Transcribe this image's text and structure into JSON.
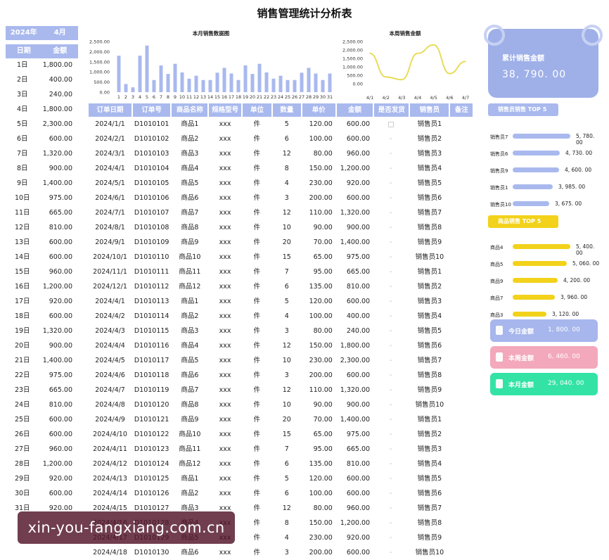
{
  "title": "销售管理统计分析表",
  "left": {
    "year": "2024年",
    "month": "4月",
    "col_day": "日期",
    "col_amount": "金额",
    "days": [
      [
        "1日",
        "1,800.00"
      ],
      [
        "2日",
        "400.00"
      ],
      [
        "3日",
        "240.00"
      ],
      [
        "4日",
        "1,800.00"
      ],
      [
        "5日",
        "2,300.00"
      ],
      [
        "6日",
        "600.00"
      ],
      [
        "7日",
        "1,320.00"
      ],
      [
        "8日",
        "900.00"
      ],
      [
        "9日",
        "1,400.00"
      ],
      [
        "10日",
        "975.00"
      ],
      [
        "11日",
        "665.00"
      ],
      [
        "12日",
        "810.00"
      ],
      [
        "13日",
        "600.00"
      ],
      [
        "14日",
        "600.00"
      ],
      [
        "15日",
        "960.00"
      ],
      [
        "16日",
        "1,200.00"
      ],
      [
        "17日",
        "920.00"
      ],
      [
        "18日",
        "600.00"
      ],
      [
        "19日",
        "1,320.00"
      ],
      [
        "20日",
        "900.00"
      ],
      [
        "21日",
        "1,400.00"
      ],
      [
        "22日",
        "975.00"
      ],
      [
        "23日",
        "665.00"
      ],
      [
        "24日",
        "810.00"
      ],
      [
        "25日",
        "600.00"
      ],
      [
        "26日",
        "600.00"
      ],
      [
        "27日",
        "960.00"
      ],
      [
        "28日",
        "1,200.00"
      ],
      [
        "29日",
        "920.00"
      ],
      [
        "30日",
        "600.00"
      ],
      [
        "31日",
        "920.00"
      ]
    ]
  },
  "chart_data": [
    {
      "type": "bar",
      "title": "本月销售数据图",
      "categories": [
        "1",
        "2",
        "3",
        "4",
        "5",
        "6",
        "7",
        "8",
        "9",
        "10",
        "11",
        "12",
        "13",
        "14",
        "15",
        "16",
        "17",
        "18",
        "19",
        "20",
        "21",
        "22",
        "23",
        "24",
        "25",
        "26",
        "27",
        "28",
        "29",
        "30",
        "31"
      ],
      "values": [
        1800,
        400,
        240,
        1800,
        2300,
        600,
        1320,
        900,
        1400,
        975,
        665,
        810,
        600,
        600,
        960,
        1200,
        920,
        600,
        1320,
        900,
        1400,
        975,
        665,
        810,
        600,
        600,
        960,
        1200,
        920,
        600,
        920
      ],
      "yticks": [
        "2,500.00",
        "2,000.00",
        "1,500.00",
        "1,000.00",
        "500.00",
        "0.00"
      ],
      "ylim": [
        0,
        2500
      ],
      "color": "#a9b9ee"
    },
    {
      "type": "line",
      "title": "本周销售金额",
      "categories": [
        "4/1",
        "4/2",
        "4/3",
        "4/4",
        "4/5",
        "4/6",
        "4/7"
      ],
      "values": [
        1800,
        400,
        240,
        1800,
        2300,
        600,
        1320
      ],
      "yticks": [
        "2,500.00",
        "2,000.00",
        "1,500.00",
        "1,000.00",
        "500.00",
        "0.00"
      ],
      "ylim": [
        0,
        2500
      ],
      "color": "#e8dc5a"
    }
  ],
  "table": {
    "headers": [
      "订单日期",
      "订单号",
      "商品名称",
      "规格型号",
      "单位",
      "数量",
      "单价",
      "金额",
      "是否发货",
      "销售员",
      "备注"
    ],
    "rows": [
      [
        "2024/1/1",
        "D1010101",
        "商品1",
        "xxx",
        "件",
        "5",
        "120.00",
        "600.00",
        "chk",
        "销售员1"
      ],
      [
        "2024/2/1",
        "D1010102",
        "商品2",
        "xxx",
        "件",
        "6",
        "100.00",
        "600.00",
        "-",
        "销售员2"
      ],
      [
        "2024/3/1",
        "D1010103",
        "商品3",
        "xxx",
        "件",
        "12",
        "80.00",
        "960.00",
        "-",
        "销售员3"
      ],
      [
        "2024/4/1",
        "D1010104",
        "商品4",
        "xxx",
        "件",
        "8",
        "150.00",
        "1,200.00",
        "-",
        "销售员4"
      ],
      [
        "2024/5/1",
        "D1010105",
        "商品5",
        "xxx",
        "件",
        "4",
        "230.00",
        "920.00",
        "-",
        "销售员5"
      ],
      [
        "2024/6/1",
        "D1010106",
        "商品6",
        "xxx",
        "件",
        "3",
        "200.00",
        "600.00",
        "-",
        "销售员6"
      ],
      [
        "2024/7/1",
        "D1010107",
        "商品7",
        "xxx",
        "件",
        "12",
        "110.00",
        "1,320.00",
        "-",
        "销售员7"
      ],
      [
        "2024/8/1",
        "D1010108",
        "商品8",
        "xxx",
        "件",
        "10",
        "90.00",
        "900.00",
        "-",
        "销售员8"
      ],
      [
        "2024/9/1",
        "D1010109",
        "商品9",
        "xxx",
        "件",
        "20",
        "70.00",
        "1,400.00",
        "-",
        "销售员9"
      ],
      [
        "2024/10/1",
        "D1010110",
        "商品10",
        "xxx",
        "件",
        "15",
        "65.00",
        "975.00",
        "-",
        "销售员10"
      ],
      [
        "2024/11/1",
        "D1010111",
        "商品11",
        "xxx",
        "件",
        "7",
        "95.00",
        "665.00",
        "-",
        "销售员1"
      ],
      [
        "2024/12/1",
        "D1010112",
        "商品12",
        "xxx",
        "件",
        "6",
        "135.00",
        "810.00",
        "-",
        "销售员2"
      ],
      [
        "2024/4/1",
        "D1010113",
        "商品1",
        "xxx",
        "件",
        "5",
        "120.00",
        "600.00",
        "-",
        "销售员3"
      ],
      [
        "2024/4/2",
        "D1010114",
        "商品2",
        "xxx",
        "件",
        "4",
        "100.00",
        "400.00",
        "-",
        "销售员4"
      ],
      [
        "2024/4/3",
        "D1010115",
        "商品3",
        "xxx",
        "件",
        "3",
        "80.00",
        "240.00",
        "-",
        "销售员5"
      ],
      [
        "2024/4/4",
        "D1010116",
        "商品4",
        "xxx",
        "件",
        "12",
        "150.00",
        "1,800.00",
        "-",
        "销售员6"
      ],
      [
        "2024/4/5",
        "D1010117",
        "商品5",
        "xxx",
        "件",
        "10",
        "230.00",
        "2,300.00",
        "-",
        "销售员7"
      ],
      [
        "2024/4/6",
        "D1010118",
        "商品6",
        "xxx",
        "件",
        "3",
        "200.00",
        "600.00",
        "-",
        "销售员8"
      ],
      [
        "2024/4/7",
        "D1010119",
        "商品7",
        "xxx",
        "件",
        "12",
        "110.00",
        "1,320.00",
        "-",
        "销售员9"
      ],
      [
        "2024/4/8",
        "D1010120",
        "商品8",
        "xxx",
        "件",
        "10",
        "90.00",
        "900.00",
        "-",
        "销售员10"
      ],
      [
        "2024/4/9",
        "D1010121",
        "商品9",
        "xxx",
        "件",
        "20",
        "70.00",
        "1,400.00",
        "-",
        "销售员1"
      ],
      [
        "2024/4/10",
        "D1010122",
        "商品10",
        "xxx",
        "件",
        "15",
        "65.00",
        "975.00",
        "-",
        "销售员2"
      ],
      [
        "2024/4/11",
        "D1010123",
        "商品11",
        "xxx",
        "件",
        "7",
        "95.00",
        "665.00",
        "-",
        "销售员3"
      ],
      [
        "2024/4/12",
        "D1010124",
        "商品12",
        "xxx",
        "件",
        "6",
        "135.00",
        "810.00",
        "-",
        "销售员4"
      ],
      [
        "2024/4/13",
        "D1010125",
        "商品1",
        "xxx",
        "件",
        "5",
        "120.00",
        "600.00",
        "-",
        "销售员5"
      ],
      [
        "2024/4/14",
        "D1010126",
        "商品2",
        "xxx",
        "件",
        "6",
        "100.00",
        "600.00",
        "-",
        "销售员6"
      ],
      [
        "2024/4/15",
        "D1010127",
        "商品3",
        "xxx",
        "件",
        "12",
        "80.00",
        "960.00",
        "-",
        "销售员7"
      ],
      [
        "2024/4/16",
        "D1010128",
        "商品4",
        "xxx",
        "件",
        "8",
        "150.00",
        "1,200.00",
        "-",
        "销售员8"
      ],
      [
        "2024/4/17",
        "D1010129",
        "商品5",
        "xxx",
        "件",
        "4",
        "230.00",
        "920.00",
        "-",
        "销售员9"
      ],
      [
        "2024/4/18",
        "D1010130",
        "商品6",
        "xxx",
        "件",
        "3",
        "200.00",
        "600.00",
        "-",
        "销售员10"
      ]
    ]
  },
  "right": {
    "total_label": "累计销售金额",
    "total_value": "38, 790. 00",
    "seller_tag": "销售员销售 TOP 5",
    "sellers": [
      {
        "name": "销售员7",
        "value": "5, 780. 00",
        "fraction": 1.0
      },
      {
        "name": "销售员6",
        "value": "4, 730. 00",
        "fraction": 0.82
      },
      {
        "name": "销售员9",
        "value": "4, 600. 00",
        "fraction": 0.8
      },
      {
        "name": "销售员1",
        "value": "3, 985. 00",
        "fraction": 0.69
      },
      {
        "name": "销售员10",
        "value": "3, 675. 00",
        "fraction": 0.64
      }
    ],
    "product_tag": "商品销售 TOP 5",
    "products": [
      {
        "name": "商品4",
        "value": "5, 400. 00",
        "fraction": 1.0
      },
      {
        "name": "商品5",
        "value": "5, 060. 00",
        "fraction": 0.94
      },
      {
        "name": "商品9",
        "value": "4, 200. 00",
        "fraction": 0.78
      },
      {
        "name": "商品7",
        "value": "3, 960. 00",
        "fraction": 0.73
      },
      {
        "name": "商品3",
        "value": "3, 120. 00",
        "fraction": 0.58
      }
    ],
    "cards": [
      {
        "label": "今日金额",
        "value": "1, 800. 00",
        "color": "#a7b6ec"
      },
      {
        "label": "本周金额",
        "value": "6, 460. 00",
        "color": "#f3a8bb"
      },
      {
        "label": "本月金额",
        "value": "29, 040. 00",
        "color": "#33e3a5"
      }
    ],
    "seller_color": "#a9b9ee",
    "product_color": "#f2d21a"
  },
  "watermark": "xin-you-fangxiang.com.cn"
}
